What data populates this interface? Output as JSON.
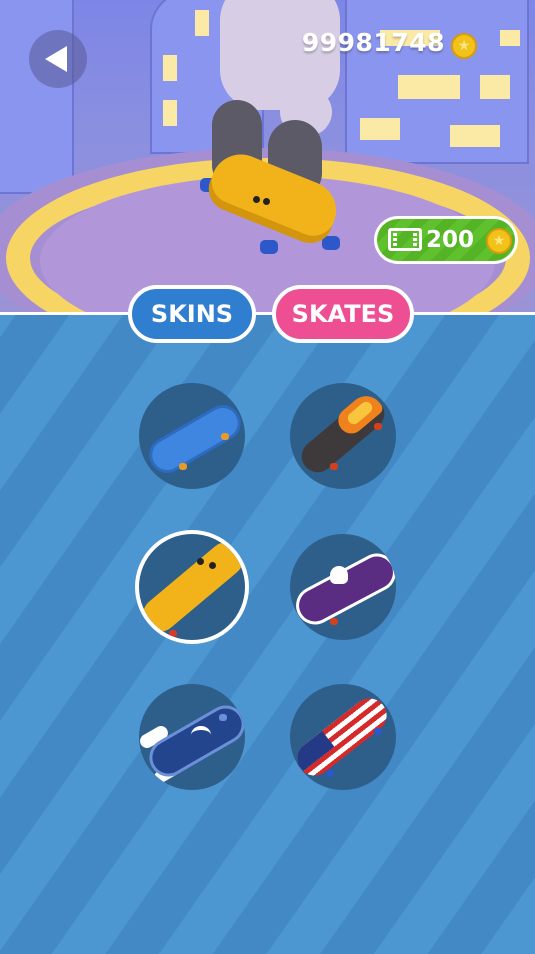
{
  "hud": {
    "coin_total": "99981748",
    "video_reward_cost": "200"
  },
  "tabs": [
    {
      "label": "SKINS",
      "active": false
    },
    {
      "label": "SKATES",
      "active": true
    }
  ],
  "skates": [
    {
      "name": "blue",
      "selected": false
    },
    {
      "name": "flame",
      "selected": false
    },
    {
      "name": "yellow-face",
      "selected": true
    },
    {
      "name": "purple-skull",
      "selected": false
    },
    {
      "name": "blue-wings",
      "selected": false
    },
    {
      "name": "usa-flag",
      "selected": false
    }
  ],
  "colors": {
    "tab_skins": "#2f7ecf",
    "tab_skates": "#ee4e92",
    "video_green": "#5fc12e",
    "coin_gold": "#f2c21c"
  }
}
